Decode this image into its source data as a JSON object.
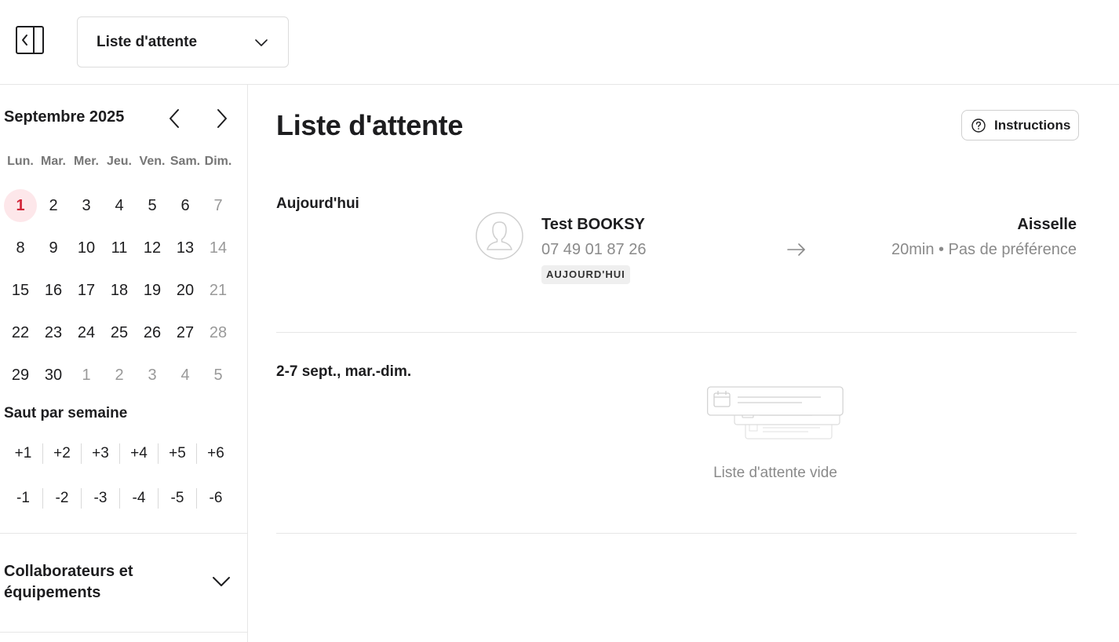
{
  "topbar": {
    "collapse_icon": "sidebar-collapse-icon",
    "view_select": {
      "value": "Liste d'attente",
      "icon": "chevron-down-icon"
    }
  },
  "sidebar": {
    "calendar": {
      "month": "Septembre 2025",
      "weekdays": [
        "Lun.",
        "Mar.",
        "Mer.",
        "Jeu.",
        "Ven.",
        "Sam.",
        "Dim."
      ],
      "days": [
        "1",
        "2",
        "3",
        "4",
        "5",
        "6",
        "7",
        "8",
        "9",
        "10",
        "11",
        "12",
        "13",
        "14",
        "15",
        "16",
        "17",
        "18",
        "19",
        "20",
        "21",
        "22",
        "23",
        "24",
        "25",
        "26",
        "27",
        "28",
        "29",
        "30",
        "1",
        "2",
        "3",
        "4",
        "5"
      ],
      "today_accent": "#d2283b"
    },
    "week_jump": {
      "title": "Saut par semaine",
      "plus": [
        "+1",
        "+2",
        "+3",
        "+4",
        "+5",
        "+6"
      ],
      "minus": [
        "-1",
        "-2",
        "-3",
        "-4",
        "-5",
        "-6"
      ]
    },
    "collaborators": {
      "label": "Collaborateurs et équipements"
    }
  },
  "main": {
    "title": "Liste d'attente",
    "instructions_label": "Instructions",
    "sections": [
      {
        "label": "Aujourd'hui",
        "entry": {
          "client_name": "Test BOOKSY",
          "phone": "07 49 01 87 26",
          "badge": "AUJOURD'HUI",
          "service": "Aisselle",
          "details": "20min • Pas de préférence"
        }
      },
      {
        "label": "2-7 sept., mar.-dim.",
        "empty_text": "Liste d'attente vide"
      }
    ]
  }
}
